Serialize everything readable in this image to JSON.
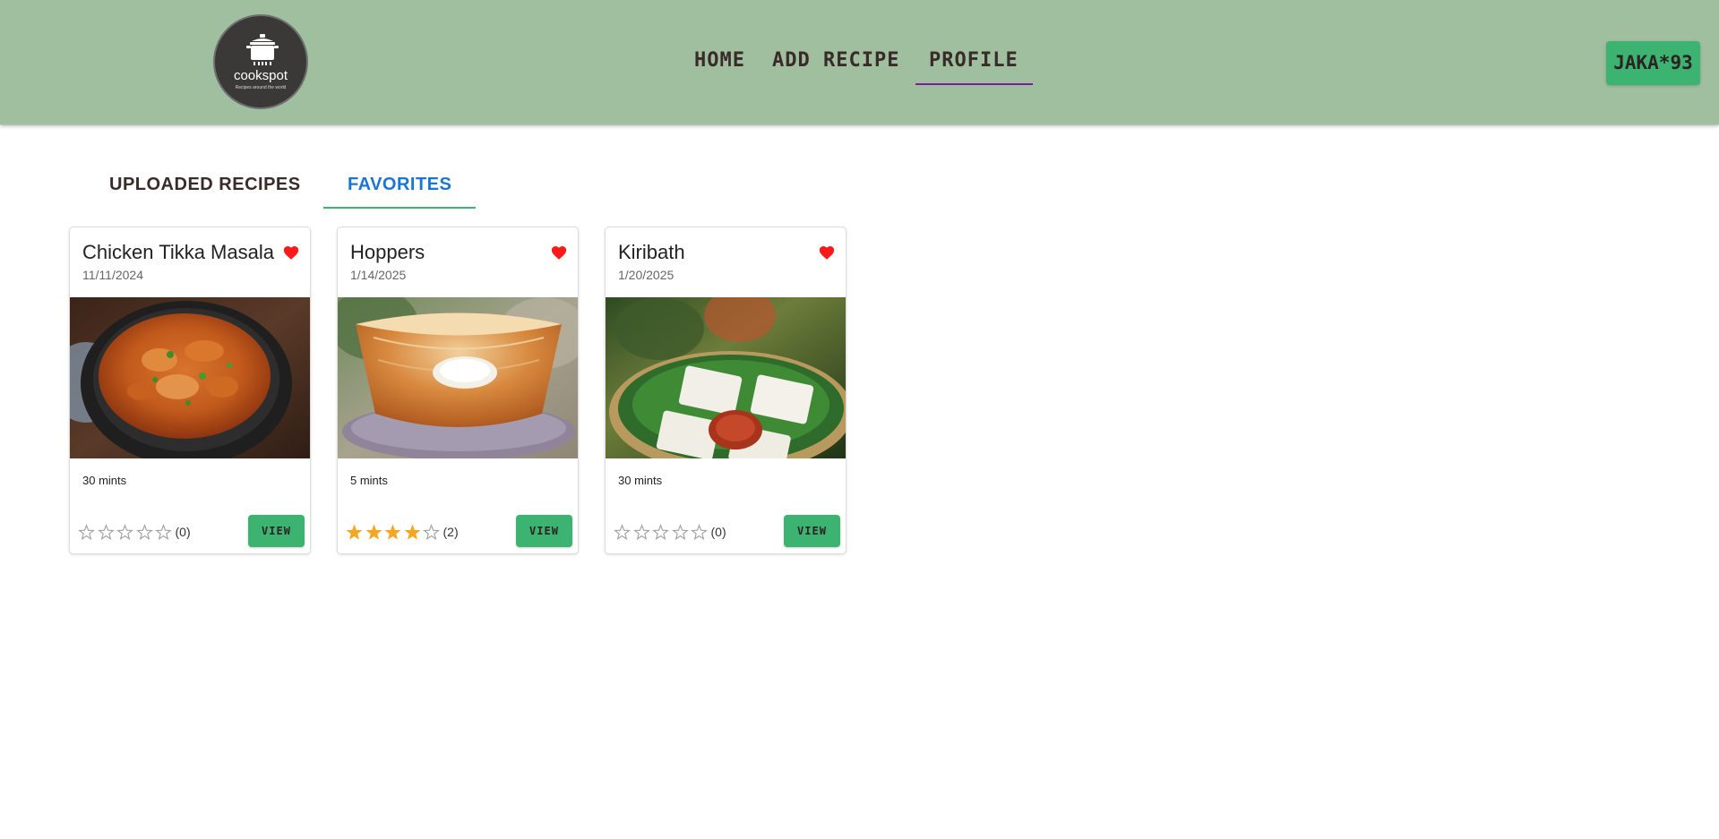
{
  "logo": {
    "brand": "cookspot",
    "tagline": "Recipes around the world",
    "icon": "cooking-pot-icon"
  },
  "nav": {
    "home": "HOME",
    "add_recipe": "ADD RECIPE",
    "profile": "PROFILE",
    "active": "PROFILE"
  },
  "user": {
    "label": "JAKA*93"
  },
  "tabs": {
    "uploaded": "UPLOADED RECIPES",
    "favorites": "FAVORITES",
    "active": "FAVORITES"
  },
  "colors": {
    "appbar": "#9fbf9f",
    "accent_green": "#3cb371",
    "tab_blue": "#1976d2",
    "heart_red": "#ff1a1a",
    "star_gold": "#f5a623",
    "nav_underline": "#7b1fa2"
  },
  "cards": [
    {
      "title": "Chicken Tikka Masala",
      "date": "11/11/2024",
      "time": "30 mints",
      "rating": 0,
      "rating_count": "(0)",
      "favorite": true,
      "image": "chicken-tikka-masala-photo",
      "view_label": "VIEW"
    },
    {
      "title": "Hoppers",
      "date": "1/14/2025",
      "time": "5 mints",
      "rating": 4,
      "rating_count": "(2)",
      "favorite": true,
      "image": "hoppers-photo",
      "view_label": "VIEW"
    },
    {
      "title": "Kiribath",
      "date": "1/20/2025",
      "time": "30 mints",
      "rating": 0,
      "rating_count": "(0)",
      "favorite": true,
      "image": "kiribath-photo",
      "view_label": "VIEW"
    }
  ]
}
